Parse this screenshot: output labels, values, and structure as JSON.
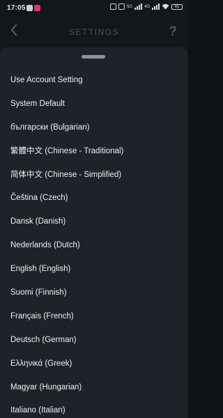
{
  "status_bar": {
    "time": "17:05",
    "network_labels": [
      "5G",
      "4G"
    ],
    "battery": "65"
  },
  "header": {
    "title": "SETTINGS",
    "back_icon": "chevron-left-icon",
    "help_icon": "question-mark-icon"
  },
  "language_sheet": {
    "options": [
      "Use Account Setting",
      "System Default",
      "български (Bulgarian)",
      "繁體中文 (Chinese - Traditional)",
      "简体中文 (Chinese - Simplified)",
      "Čeština (Czech)",
      "Dansk (Danish)",
      "Nederlands (Dutch)",
      "English (English)",
      "Suomi (Finnish)",
      "Français (French)",
      "Deutsch (German)",
      "Ελληνικά (Greek)",
      "Magyar (Hungarian)",
      "Italiano (Italian)"
    ]
  }
}
